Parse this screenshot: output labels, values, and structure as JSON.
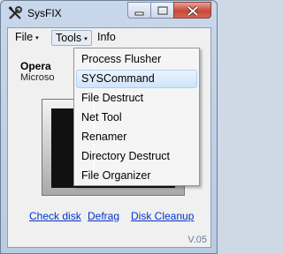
{
  "window": {
    "title": "SysFIX",
    "icon": "wrench-screwdriver-icon"
  },
  "menubar": {
    "file": "File",
    "tools": "Tools",
    "info": "Info",
    "arrow": "▾"
  },
  "tools_menu": {
    "items": [
      {
        "label": "Process Flusher"
      },
      {
        "label": "SYSCommand",
        "highlighted": true
      },
      {
        "label": "File Destruct"
      },
      {
        "label": "Net Tool"
      },
      {
        "label": "Renamer"
      },
      {
        "label": "Directory Destruct"
      },
      {
        "label": "File Organizer"
      }
    ]
  },
  "main": {
    "os_label": "Opera",
    "os_value": "Microso"
  },
  "links": {
    "check_disk": "Check disk",
    "defrag": "Defrag",
    "disk_cleanup": "Disk Cleanup"
  },
  "version": "V.05",
  "colors": {
    "link": "#0033cc",
    "highlight": "#cfe4fb",
    "close_button": "#c8483a"
  }
}
